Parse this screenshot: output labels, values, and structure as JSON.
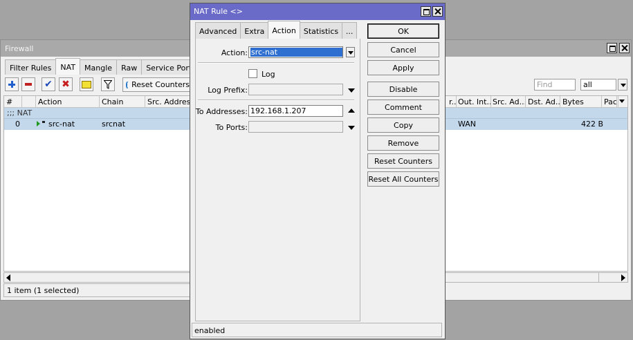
{
  "firewall": {
    "title": "Firewall",
    "tabs": [
      "Filter Rules",
      "NAT",
      "Mangle",
      "Raw",
      "Service Ports"
    ],
    "active_tab": "NAT",
    "toolbar": {
      "reset_counters_label": "Reset Counters",
      "find_placeholder": "Find",
      "filter_value": "all"
    },
    "columns": {
      "num": "#",
      "action": "Action",
      "chain": "Chain",
      "src_address": "Src. Address",
      "in_int_partial": "r...",
      "out_interface": "Out. Int...",
      "src_address_list": "Src. Ad...",
      "dst_address_list": "Dst. Ad...",
      "bytes": "Bytes",
      "packets": "Pac"
    },
    "comment_row": ";;; NAT",
    "rows": [
      {
        "num": "0",
        "action": "src-nat",
        "chain": "srcnat",
        "out_interface": "WAN",
        "bytes": "422 B"
      }
    ],
    "status": "1 item (1 selected)"
  },
  "dialog": {
    "title": "NAT Rule <>",
    "tabs": [
      "Advanced",
      "Extra",
      "Action",
      "Statistics",
      "..."
    ],
    "active_tab": "Action",
    "fields": {
      "action_label": "Action:",
      "action_value": "src-nat",
      "log_label": "Log",
      "log_checked": false,
      "log_prefix_label": "Log Prefix:",
      "log_prefix_value": "",
      "to_addresses_label": "To Addresses:",
      "to_addresses_value": "192.168.1.207",
      "to_ports_label": "To Ports:",
      "to_ports_value": ""
    },
    "buttons": {
      "ok": "OK",
      "cancel": "Cancel",
      "apply": "Apply",
      "disable": "Disable",
      "comment": "Comment",
      "copy": "Copy",
      "remove": "Remove",
      "reset_counters": "Reset Counters",
      "reset_all_counters": "Reset All Counters"
    },
    "status": "enabled"
  },
  "colors": {
    "dialog_title_bg": "#6a6ac8",
    "inactive_title_bg": "#a9a9a9",
    "selected_row_bg": "#c4d8ec",
    "selection_highlight": "#2f6fd0",
    "desktop_bg": "#a3a3a3"
  }
}
